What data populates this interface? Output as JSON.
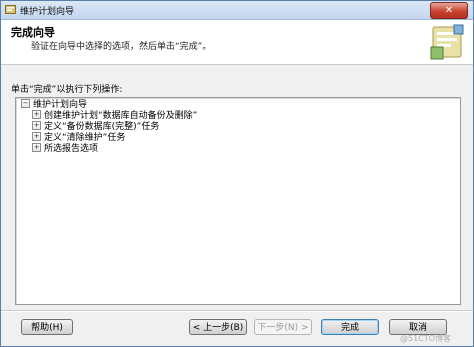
{
  "window": {
    "title": "维护计划向导",
    "close_glyph": "✕"
  },
  "header": {
    "title": "完成向导",
    "subtitle": "验证在向导中选择的选项，然后单击“完成”。"
  },
  "instruction": "单击“完成”以执行下列操作:",
  "tree": {
    "root": {
      "label": "维护计划向导",
      "expander": "⊟"
    },
    "items": [
      {
        "label": "创建维护计划“数据库自动备份及删除”",
        "expander": "+"
      },
      {
        "label": "定义“备份数据库(完整)”任务",
        "expander": "+"
      },
      {
        "label": "定义“清除维护”任务",
        "expander": "+"
      },
      {
        "label": "所选报告选项",
        "expander": "+"
      }
    ]
  },
  "buttons": {
    "help": "帮助(H)",
    "back": "< 上一步(B)",
    "next": "下一步(N) >",
    "finish": "完成",
    "cancel": "取消"
  },
  "watermark": "@51CTO博客",
  "icons": {
    "app": "wizard-app-icon",
    "header": "wizard-graphic-icon"
  }
}
